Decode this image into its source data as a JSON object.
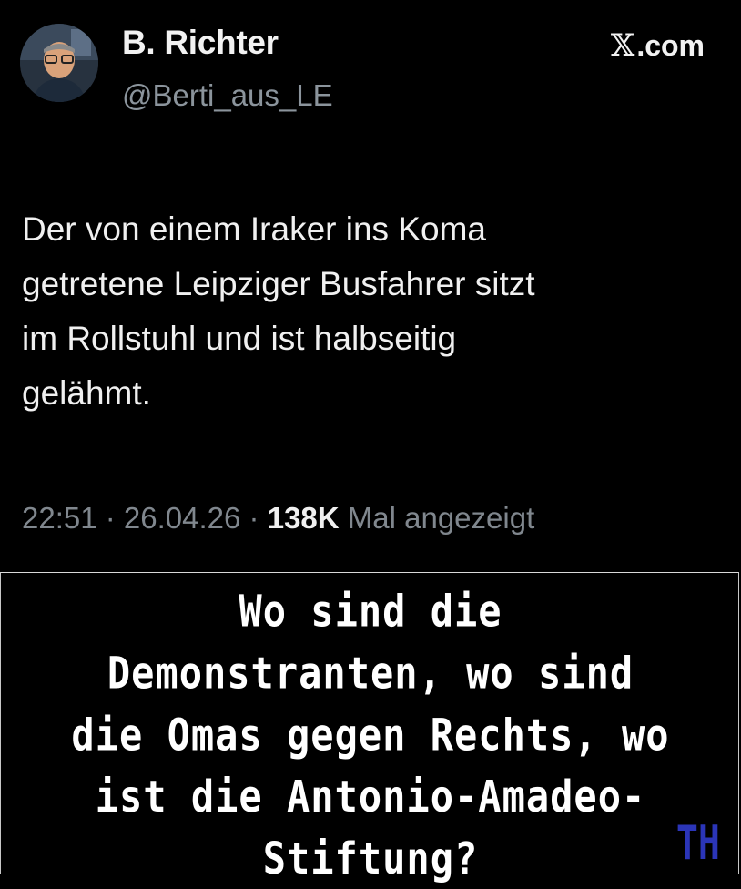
{
  "post": {
    "author_name": "B. Richter",
    "author_handle": "@Berti_aus_LE",
    "brand": {
      "x_glyph": "𝕏",
      "suffix": ".com"
    },
    "text": "Der von einem Iraker ins Koma\ngetretene Leipziger Busfahrer sitzt\nim Rollstuhl und ist halbseitig\ngelähmt.",
    "time": "22:51",
    "separator": " · ",
    "date": "26.04.26",
    "views_count": "138K",
    "views_label": "Mal angezeigt"
  },
  "caption": {
    "lines": [
      "Wo sind die",
      "Demonstranten, wo sind",
      "die Omas gegen Rechts, wo",
      "ist die Antonio-Amadeo-",
      "Stiftung?"
    ]
  },
  "watermark": "TH",
  "colors": {
    "background": "#000000",
    "text_primary": "#f0f0f0",
    "text_secondary": "#80878e",
    "watermark": "#2b35b8"
  }
}
